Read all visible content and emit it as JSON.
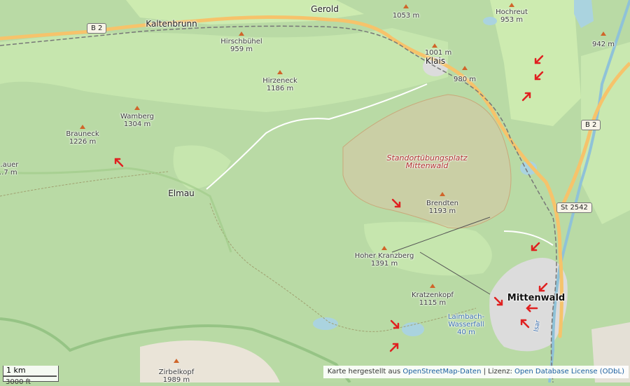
{
  "map": {
    "towns": [
      {
        "name": "Kaltenbrunn"
      },
      {
        "name": "Gerold"
      },
      {
        "name": "Klais"
      },
      {
        "name": "Elmau"
      },
      {
        "name": "Mittenwald"
      }
    ],
    "peaks": [
      {
        "name": "Hirschbühel",
        "elev": "959 m"
      },
      {
        "name": "Hirzeneck",
        "elev": "1186 m"
      },
      {
        "name": "Wamberg",
        "elev": "1304 m"
      },
      {
        "name": "Brauneck",
        "elev": "1226 m"
      },
      {
        "name": "Hochreut",
        "elev": "953 m"
      },
      {
        "name": "",
        "elev": "1053 m"
      },
      {
        "name": "",
        "elev": "1001 m"
      },
      {
        "name": "",
        "elev": "980 m"
      },
      {
        "name": "",
        "elev": "942 m"
      },
      {
        "name": "Brendten",
        "elev": "1193 m"
      },
      {
        "name": "Hoher Kranzberg",
        "elev": "1391 m"
      },
      {
        "name": "Kratzenkopf",
        "elev": "1115 m"
      },
      {
        "name": "Zirbelkopf",
        "elev": "1989 m"
      },
      {
        "name": "…auer",
        "elev": "…7 m"
      }
    ],
    "military_area": {
      "line1": "Standortübungsplatz",
      "line2": "Mittenwald"
    },
    "waterfall": {
      "line1": "Laimbach-",
      "line2": "Wasserfall",
      "elev": "40 m"
    },
    "roads": {
      "b2_west": "B 2",
      "b2_east": "B 2",
      "st": "St 2542"
    },
    "river_label": "Isar",
    "scale": {
      "metric": "1 km",
      "imperial": "3000 ft"
    },
    "attribution": {
      "prefix": "Karte hergestellt aus",
      "osm": "OpenStreetMap-Daten",
      "sep": "| Lizenz:",
      "license": "Open Database License (ODbL)"
    },
    "colors": {
      "forest": "#b7d8a4",
      "meadow": "#cdebb0",
      "water": "#aad3df",
      "military": "#d9c7a6",
      "arrow": "#e02020",
      "town": "#e0dfdf",
      "rock": "#eae4d8"
    },
    "arrow_markers": [
      {
        "dir": "down-left"
      },
      {
        "dir": "down-left"
      },
      {
        "dir": "up-right"
      },
      {
        "dir": "up-left"
      },
      {
        "dir": "down-right"
      },
      {
        "dir": "down-left"
      },
      {
        "dir": "down-left"
      },
      {
        "dir": "down-right"
      },
      {
        "dir": "left"
      },
      {
        "dir": "up-left"
      },
      {
        "dir": "down-right"
      },
      {
        "dir": "up-right"
      },
      {
        "dir": "up-left"
      }
    ]
  }
}
